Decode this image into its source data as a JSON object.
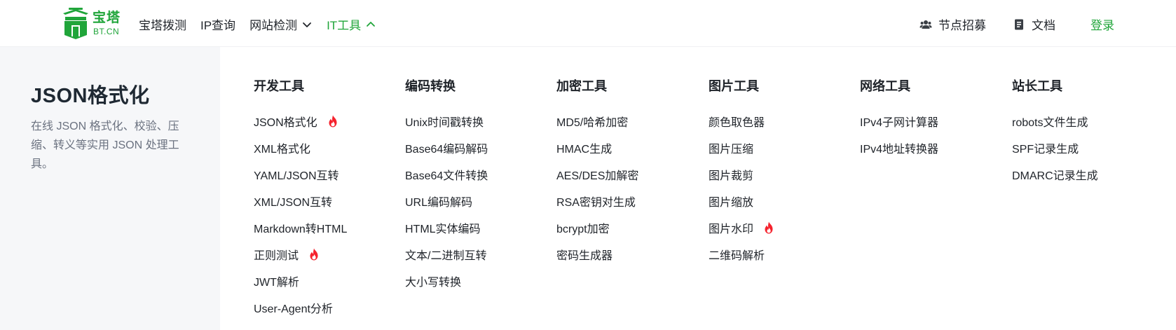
{
  "header": {
    "logo": {
      "cn": "宝塔",
      "en": "BT.CN"
    },
    "nav": [
      {
        "label": "宝塔拨测",
        "dropdown": false,
        "active": false
      },
      {
        "label": "IP查询",
        "dropdown": false,
        "active": false
      },
      {
        "label": "网站检测",
        "dropdown": true,
        "active": false
      },
      {
        "label": "IT工具",
        "dropdown": true,
        "active": true
      }
    ],
    "right": {
      "recruit": {
        "label": "节点招募",
        "icon": "users-icon"
      },
      "docs": {
        "label": "文档",
        "icon": "document-icon"
      },
      "login": "登录"
    }
  },
  "current_tool": {
    "title": "JSON格式化",
    "description": "在线 JSON 格式化、校验、压缩、转义等实用 JSON 处理工具。"
  },
  "menu": {
    "columns": [
      {
        "title": "开发工具",
        "items": [
          {
            "label": "JSON格式化",
            "hot": true
          },
          {
            "label": "XML格式化",
            "hot": false
          },
          {
            "label": "YAML/JSON互转",
            "hot": false
          },
          {
            "label": "XML/JSON互转",
            "hot": false
          },
          {
            "label": "Markdown转HTML",
            "hot": false
          },
          {
            "label": "正则测试",
            "hot": true
          },
          {
            "label": "JWT解析",
            "hot": false
          },
          {
            "label": "User-Agent分析",
            "hot": false
          }
        ]
      },
      {
        "title": "编码转换",
        "items": [
          {
            "label": "Unix时间戳转换",
            "hot": false
          },
          {
            "label": "Base64编码解码",
            "hot": false
          },
          {
            "label": "Base64文件转换",
            "hot": false
          },
          {
            "label": "URL编码解码",
            "hot": false
          },
          {
            "label": "HTML实体编码",
            "hot": false
          },
          {
            "label": "文本/二进制互转",
            "hot": false
          },
          {
            "label": "大小写转换",
            "hot": false
          }
        ]
      },
      {
        "title": "加密工具",
        "items": [
          {
            "label": "MD5/哈希加密",
            "hot": false
          },
          {
            "label": "HMAC生成",
            "hot": false
          },
          {
            "label": "AES/DES加解密",
            "hot": false
          },
          {
            "label": "RSA密钥对生成",
            "hot": false
          },
          {
            "label": "bcrypt加密",
            "hot": false
          },
          {
            "label": "密码生成器",
            "hot": false
          }
        ]
      },
      {
        "title": "图片工具",
        "items": [
          {
            "label": "颜色取色器",
            "hot": false
          },
          {
            "label": "图片压缩",
            "hot": false
          },
          {
            "label": "图片裁剪",
            "hot": false
          },
          {
            "label": "图片缩放",
            "hot": false
          },
          {
            "label": "图片水印",
            "hot": true
          },
          {
            "label": "二维码解析",
            "hot": false
          }
        ]
      },
      {
        "title": "网络工具",
        "items": [
          {
            "label": "IPv4子网计算器",
            "hot": false
          },
          {
            "label": "IPv4地址转换器",
            "hot": false
          }
        ]
      },
      {
        "title": "站长工具",
        "items": [
          {
            "label": "robots文件生成",
            "hot": false
          },
          {
            "label": "SPF记录生成",
            "hot": false
          },
          {
            "label": "DMARC记录生成",
            "hot": false
          }
        ]
      }
    ]
  },
  "colors": {
    "brand": "#20a53a",
    "hot": "#f5222d",
    "panel_bg": "#f6f7f9"
  }
}
